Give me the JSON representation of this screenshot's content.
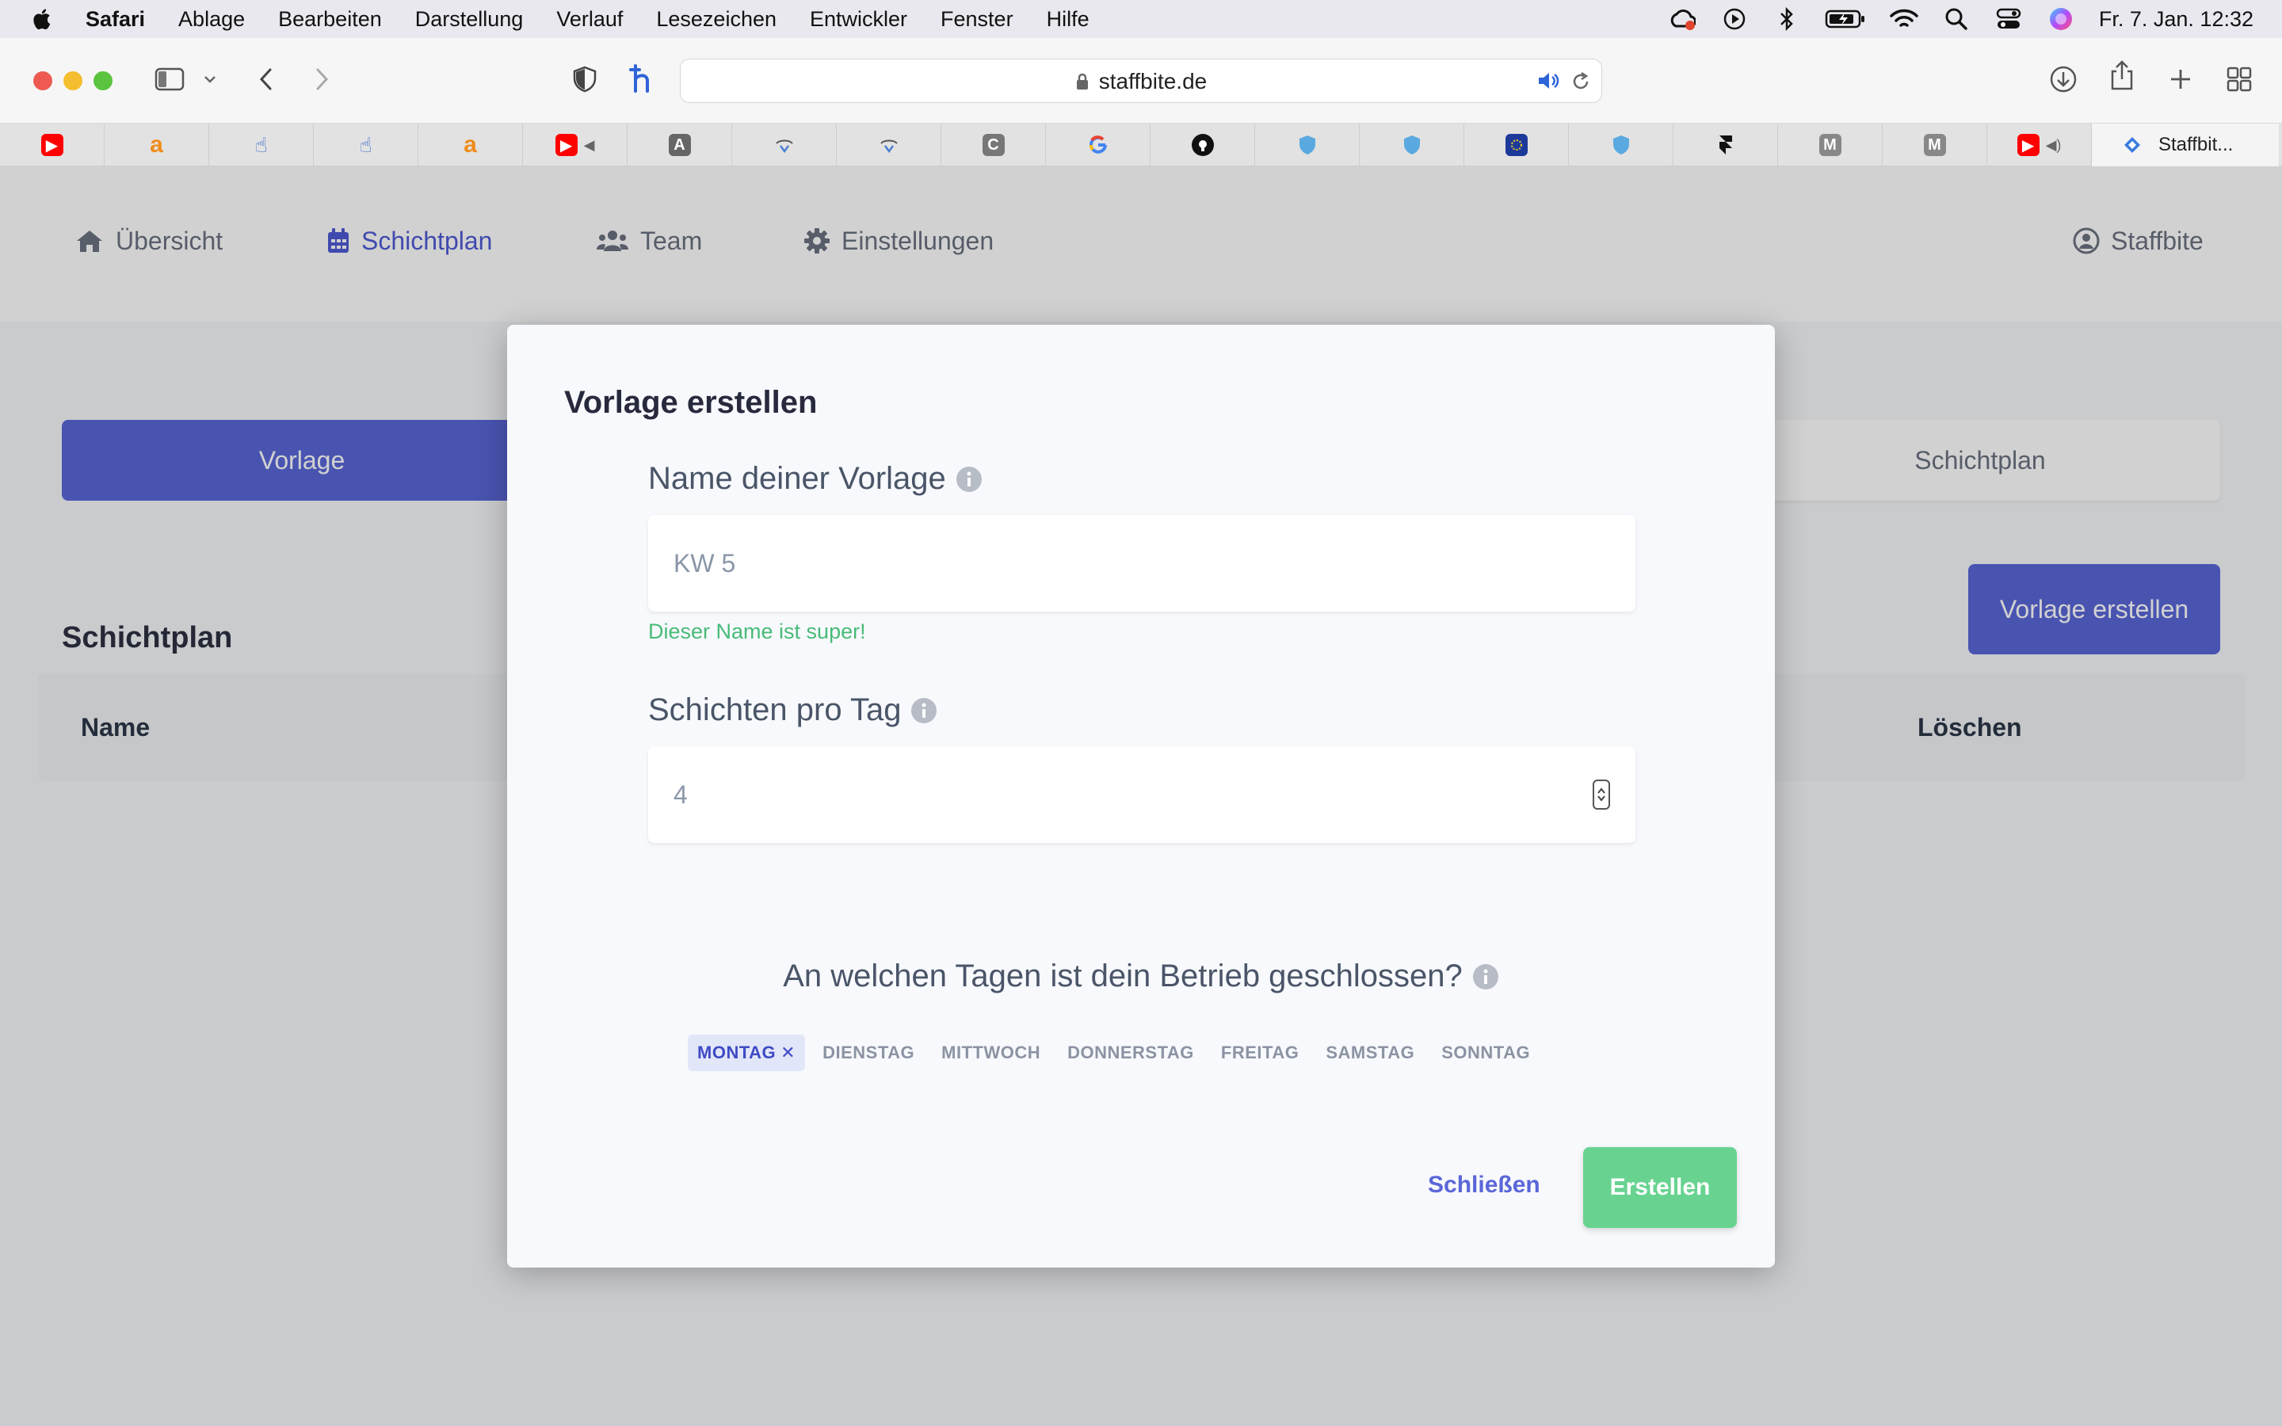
{
  "menubar": {
    "app": "Safari",
    "items": [
      "Ablage",
      "Bearbeiten",
      "Darstellung",
      "Verlauf",
      "Lesezeichen",
      "Entwickler",
      "Fenster",
      "Hilfe"
    ],
    "clock": "Fr. 7. Jan.  12:32"
  },
  "browser": {
    "url": "staffbite.de",
    "active_tab_label": "Staffbit...",
    "tab_icons": [
      "youtube-icon",
      "amazon-icon",
      "pointer-icon",
      "pointer-icon",
      "amazon-icon",
      "youtube-icon",
      "letter-a-icon",
      "site-icon",
      "site-icon",
      "letter-c-icon",
      "google-icon",
      "github-icon",
      "shield-icon",
      "shield-icon",
      "eu-icon",
      "shield-icon",
      "framer-icon",
      "letter-m-icon",
      "letter-m-icon",
      "youtube-icon"
    ]
  },
  "app": {
    "nav": {
      "overview": "Übersicht",
      "schedule": "Schichtplan",
      "team": "Team",
      "settings": "Einstellungen",
      "account": "Staffbite"
    },
    "tabs": {
      "template": "Vorlage",
      "schedule": "Schichtplan"
    },
    "create_template_button": "Vorlage erstellen",
    "section_title": "Schichtplan",
    "table": {
      "col_name": "Name",
      "col_delete": "Löschen"
    }
  },
  "modal": {
    "title": "Vorlage erstellen",
    "name_label": "Name deiner Vorlage",
    "name_value": "KW 5",
    "name_hint": "Dieser Name ist super!",
    "shifts_label": "Schichten pro Tag",
    "shifts_value": "4",
    "closed_days_label": "An welchen Tagen ist dein Betrieb geschlossen?",
    "days": [
      {
        "label": "MONTAG",
        "selected": true
      },
      {
        "label": "DIENSTAG",
        "selected": false
      },
      {
        "label": "MITTWOCH",
        "selected": false
      },
      {
        "label": "DONNERSTAG",
        "selected": false
      },
      {
        "label": "FREITAG",
        "selected": false
      },
      {
        "label": "SAMSTAG",
        "selected": false
      },
      {
        "label": "SONNTAG",
        "selected": false
      }
    ],
    "remove_mark": "✕",
    "close_button": "Schließen",
    "create_button": "Erstellen"
  },
  "colors": {
    "accent": "#5a67d8",
    "success": "#68d391",
    "hint": "#48bb78"
  }
}
